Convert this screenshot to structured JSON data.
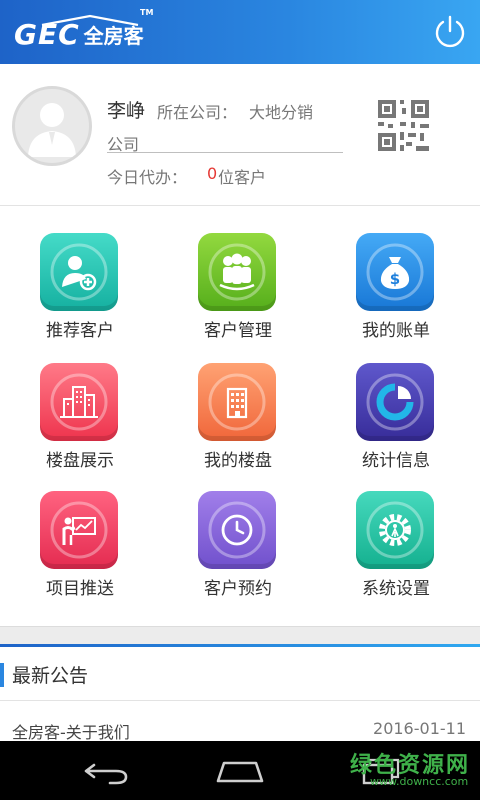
{
  "header": {
    "logo_text": "GEC",
    "logo_cn": "全房客",
    "logo_tm": "TM",
    "power_icon": "power-icon"
  },
  "profile": {
    "name": "李峥",
    "company_label": "所在公司：",
    "company_value_line1": "大地分销",
    "company_value_line2": "公司",
    "todo_label": "今日代办：",
    "todo_count": "0",
    "todo_unit": "位客户",
    "avatar_icon": "user-avatar-icon",
    "qr_icon": "qr-code-icon"
  },
  "grid": {
    "items": [
      {
        "label": "推荐客户",
        "icon": "add-customer-icon",
        "color1": "#3fd6c3",
        "color2": "#17b3a3"
      },
      {
        "label": "客户管理",
        "icon": "customers-group-icon",
        "color1": "#8bd43a",
        "color2": "#58b21e"
      },
      {
        "label": "我的账单",
        "icon": "money-bag-icon",
        "color1": "#3fa5f5",
        "color2": "#1a79d8"
      },
      {
        "label": "楼盘展示",
        "icon": "buildings-icon",
        "color1": "#ff6f7f",
        "color2": "#f0364f"
      },
      {
        "label": "我的楼盘",
        "icon": "building-icon",
        "color1": "#ff9b6a",
        "color2": "#f26a3a"
      },
      {
        "label": "统计信息",
        "icon": "pie-chart-icon",
        "color1": "#5a52c8",
        "color2": "#3b2f9e"
      },
      {
        "label": "项目推送",
        "icon": "presentation-icon",
        "color1": "#ff5a78",
        "color2": "#e72e52"
      },
      {
        "label": "客户预约",
        "icon": "clock-icon",
        "color1": "#9a78e6",
        "color2": "#7554cf"
      },
      {
        "label": "系统设置",
        "icon": "settings-gear-icon",
        "color1": "#3fd6b8",
        "color2": "#16b493"
      }
    ]
  },
  "notices": {
    "title": "最新公告",
    "items": [
      {
        "title": "全房客-关于我们",
        "date": "2016-01-11"
      }
    ]
  },
  "watermark": {
    "cn": "绿色资源网",
    "url": "www.downcc.com"
  }
}
